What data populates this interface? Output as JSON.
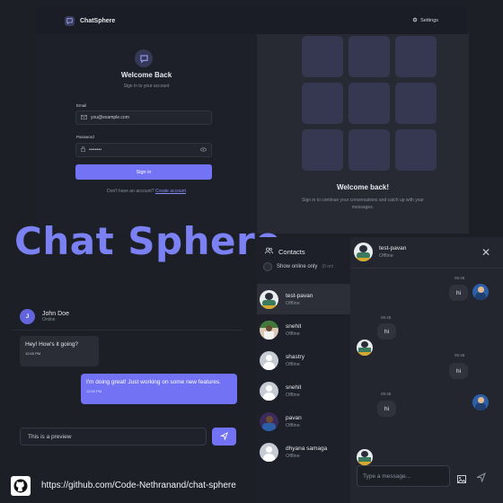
{
  "topbar": {
    "brand": "ChatSphere",
    "settings": "Settings"
  },
  "login": {
    "title": "Welcome Back",
    "subtitle": "Sign in to your account",
    "email_label": "Email",
    "email_placeholder": "you@example.com",
    "password_label": "Password",
    "password_value": "••••••••",
    "signin_label": "Sign in",
    "no_account": "Don't have an account?",
    "create_link": "Create account"
  },
  "welcome": {
    "title": "Welcome back!",
    "subtitle": "Sign in to continue your conversations and catch up with your messages."
  },
  "big_title": "Chat Sphere",
  "preview_chat": {
    "contact_initial": "J",
    "contact_name": "John Doe",
    "contact_status": "Online",
    "incoming_text": "Hey! How's it going?",
    "incoming_time": "12:00 PM",
    "outgoing_text": "I'm doing great! Just working on some new features.",
    "outgoing_time": "12:00 PM",
    "input_value": "This is a preview"
  },
  "footer": {
    "github_url": "https://github.com/Code-Nethranand/chat-sphere"
  },
  "contacts": {
    "header": "Contacts",
    "online_toggle": "Show online only",
    "online_count": "(0 onl",
    "items": [
      {
        "name": "test-pavan",
        "status": "Offline",
        "avatar": "avatar-photo-icon"
      },
      {
        "name": "snehit",
        "status": "Offline",
        "avatar": "avatar-photo-icon"
      },
      {
        "name": "shastry",
        "status": "Offline",
        "avatar": "avatar-default-icon"
      },
      {
        "name": "snehit",
        "status": "Offline",
        "avatar": "avatar-default-icon"
      },
      {
        "name": "pavan",
        "status": "Offline",
        "avatar": "avatar-photo-icon"
      },
      {
        "name": "dhyana samaga",
        "status": "Offline",
        "avatar": "avatar-default-icon"
      }
    ]
  },
  "chat": {
    "contact_name": "test-pavan",
    "contact_status": "Offline",
    "messages": [
      {
        "dir": "out",
        "text": "hi",
        "time": "09:48"
      },
      {
        "dir": "in",
        "text": "hi",
        "time": "09:48"
      },
      {
        "dir": "out",
        "text": "hi",
        "time": "09:48"
      },
      {
        "dir": "in",
        "text": "hi",
        "time": "09:48"
      }
    ],
    "input_placeholder": "Type a message..."
  },
  "colors": {
    "accent": "#7272f4",
    "background": "#1c1f26",
    "title": "#7b80f2"
  }
}
